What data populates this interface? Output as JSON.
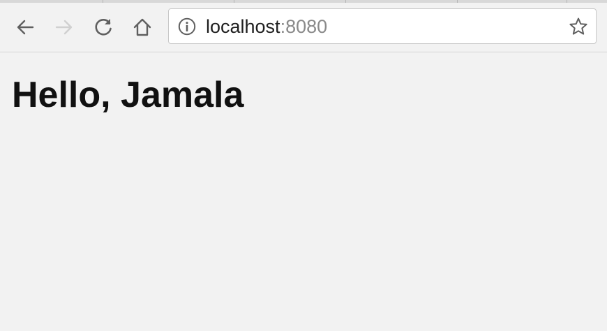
{
  "browser": {
    "address_bar": {
      "host": "localhost",
      "port": ":8080"
    },
    "toolbar": {
      "icons": [
        "back-arrow-icon",
        "forward-arrow-icon",
        "reload-icon",
        "home-icon",
        "site-info-icon",
        "bookmark-star-icon"
      ]
    },
    "colors": {
      "toolbar_background": "#f2f2f2",
      "page_background": "#f2f2f2",
      "forward_disabled": "#d0d0d0",
      "icon_active": "#5f5f5f",
      "port_text": "#8a8a8a"
    }
  },
  "page": {
    "heading": "Hello, Jamala"
  }
}
